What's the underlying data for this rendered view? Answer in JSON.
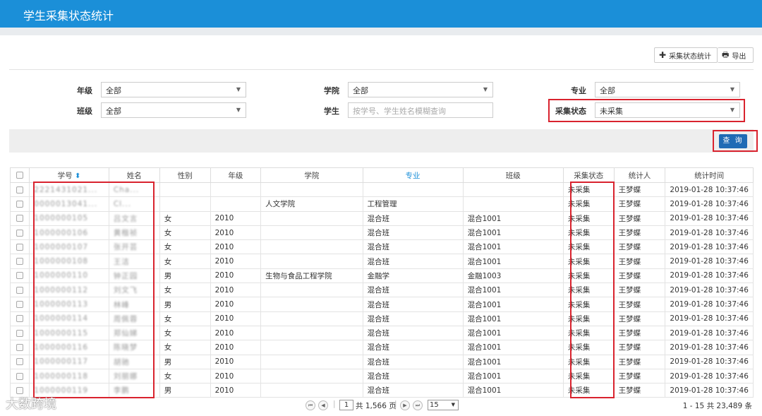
{
  "header": {
    "title": "学生采集状态统计"
  },
  "toolbar": {
    "stat_label": "采集状态统计",
    "export_label": "导出"
  },
  "filters": {
    "grade_label": "年级",
    "grade_value": "全部",
    "college_label": "学院",
    "college_value": "全部",
    "major_label": "专业",
    "major_value": "全部",
    "class_label": "班级",
    "class_value": "全部",
    "student_label": "学生",
    "student_placeholder": "按学号、学生姓名模糊查询",
    "status_label": "采集状态",
    "status_value": "未采集",
    "query_label": "查 询"
  },
  "table": {
    "headers": [
      "学号",
      "姓名",
      "性别",
      "年级",
      "学院",
      "专业",
      "班级",
      "采集状态",
      "统计人",
      "统计时间"
    ],
    "rows": [
      [
        "2221431021...",
        "Cha...",
        "",
        "",
        "",
        "",
        "",
        "未采集",
        "王梦蝶",
        "2019-01-28 10:37:46"
      ],
      [
        "0000013041...",
        "Cl...",
        "",
        "",
        "人文学院",
        "工程管理",
        "",
        "未采集",
        "王梦蝶",
        "2019-01-28 10:37:46"
      ],
      [
        "1000000105",
        "吕文言",
        "女",
        "2010",
        "",
        "混合班",
        "混合1001",
        "未采集",
        "王梦蝶",
        "2019-01-28 10:37:46"
      ],
      [
        "1000000106",
        "黄楷祯",
        "女",
        "2010",
        "",
        "混合班",
        "混合1001",
        "未采集",
        "王梦蝶",
        "2019-01-28 10:37:46"
      ],
      [
        "1000000107",
        "张开芸",
        "女",
        "2010",
        "",
        "混合班",
        "混合1001",
        "未采集",
        "王梦蝶",
        "2019-01-28 10:37:46"
      ],
      [
        "1000000108",
        "王洁",
        "女",
        "2010",
        "",
        "混合班",
        "混合1001",
        "未采集",
        "王梦蝶",
        "2019-01-28 10:37:46"
      ],
      [
        "1000000110",
        "钟正园",
        "男",
        "2010",
        "生物与食品工程学院",
        "金融学",
        "金融1003",
        "未采集",
        "王梦蝶",
        "2019-01-28 10:37:46"
      ],
      [
        "1000000112",
        "刘文飞",
        "女",
        "2010",
        "",
        "混合班",
        "混合1001",
        "未采集",
        "王梦蝶",
        "2019-01-28 10:37:46"
      ],
      [
        "1000000113",
        "林峰",
        "男",
        "2010",
        "",
        "混合班",
        "混合1001",
        "未采集",
        "王梦蝶",
        "2019-01-28 10:37:46"
      ],
      [
        "1000000114",
        "周佩蓉",
        "女",
        "2010",
        "",
        "混合班",
        "混合1001",
        "未采集",
        "王梦蝶",
        "2019-01-28 10:37:46"
      ],
      [
        "1000000115",
        "郑仙娣",
        "女",
        "2010",
        "",
        "混合班",
        "混合1001",
        "未采集",
        "王梦蝶",
        "2019-01-28 10:37:46"
      ],
      [
        "1000000116",
        "陈晓梦",
        "女",
        "2010",
        "",
        "混合班",
        "混合1001",
        "未采集",
        "王梦蝶",
        "2019-01-28 10:37:46"
      ],
      [
        "1000000117",
        "胡驰",
        "男",
        "2010",
        "",
        "混合班",
        "混合1001",
        "未采集",
        "王梦蝶",
        "2019-01-28 10:37:46"
      ],
      [
        "1000000118",
        "刘丽娜",
        "女",
        "2010",
        "",
        "混合班",
        "混合1001",
        "未采集",
        "王梦蝶",
        "2019-01-28 10:37:46"
      ],
      [
        "1000000119",
        "李鹏",
        "男",
        "2010",
        "",
        "混合班",
        "混合1001",
        "未采集",
        "王梦蝶",
        "2019-01-28 10:37:46"
      ]
    ]
  },
  "pager": {
    "page": "1",
    "total_pages_text": "共 1,566 页",
    "page_size": "15",
    "summary": "1 - 15  共 23,489 条"
  },
  "watermark": "大数跨境",
  "colors": {
    "header": "#1b8fd8",
    "highlight": "#d9232e",
    "query_button": "#1f6bb5"
  }
}
